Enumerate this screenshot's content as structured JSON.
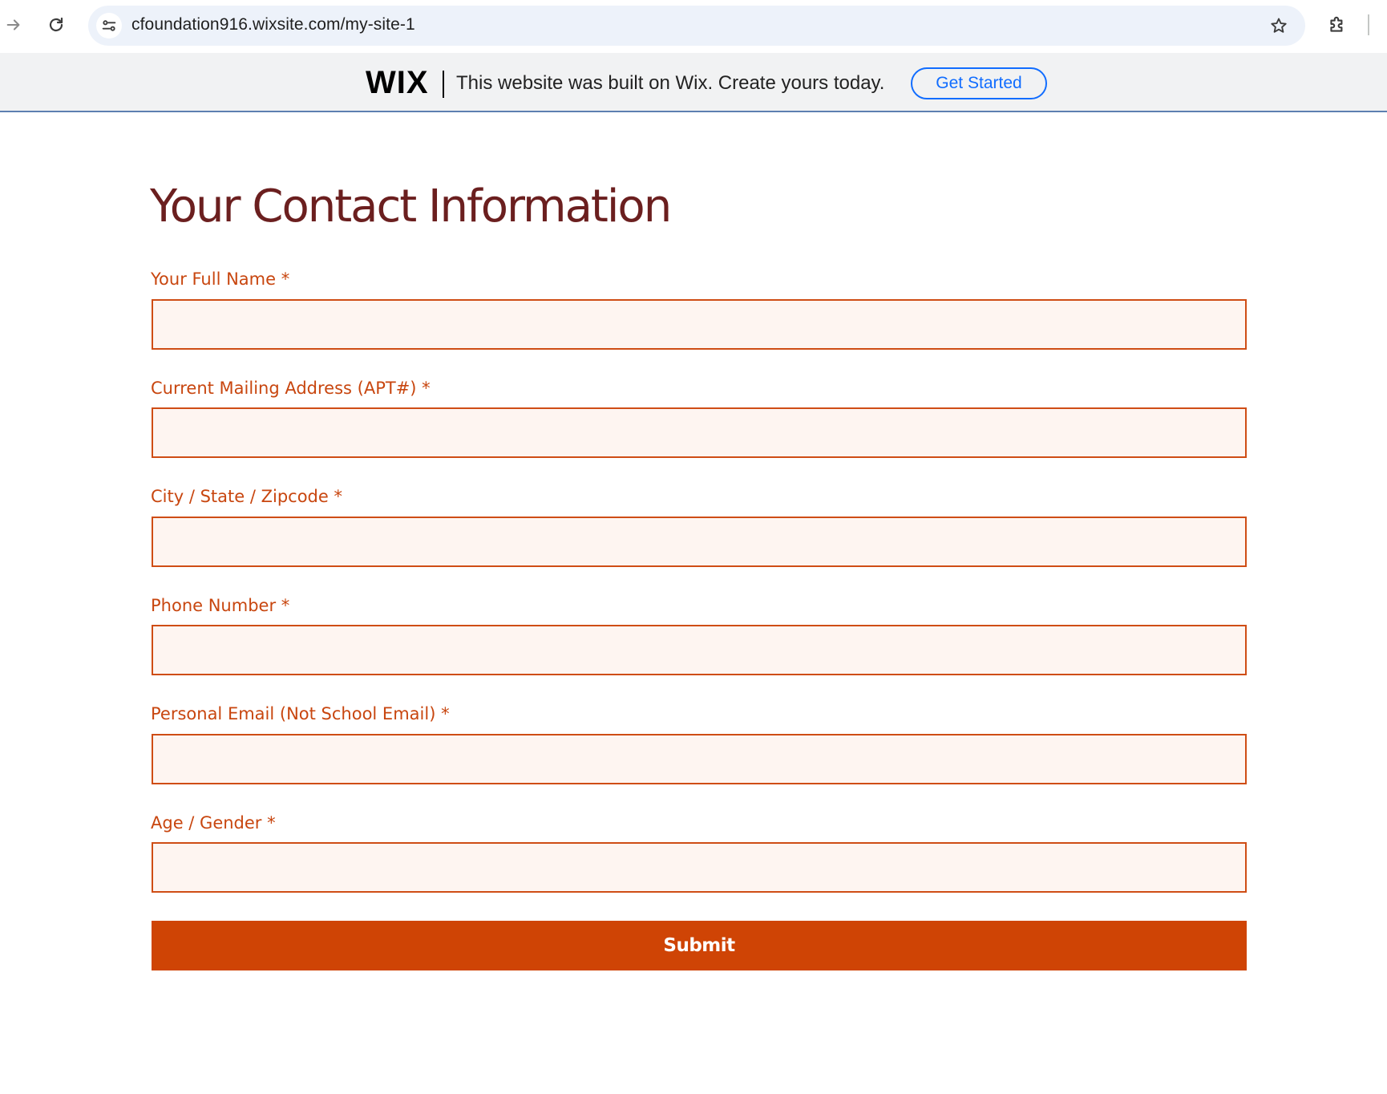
{
  "browser": {
    "url": "cfoundation916.wixsite.com/my-site-1",
    "icons": {
      "forward": "arrow-forward-icon",
      "reload": "reload-icon",
      "site_info": "tune-icon",
      "bookmark": "star-icon",
      "extensions": "puzzle-icon"
    }
  },
  "banner": {
    "logo": "WIX",
    "message": "This website was built on Wix. Create yours today.",
    "cta_label": "Get Started"
  },
  "form": {
    "title": "Your Contact Information",
    "fields": [
      {
        "label": "Your Full Name *",
        "value": ""
      },
      {
        "label": "Current Mailing Address (APT#) *",
        "value": ""
      },
      {
        "label": "City / State / Zipcode *",
        "value": ""
      },
      {
        "label": "Phone Number *",
        "value": ""
      },
      {
        "label": "Personal Email (Not School Email) *",
        "value": ""
      },
      {
        "label": "Age / Gender *",
        "value": ""
      }
    ],
    "submit_label": "Submit"
  },
  "colors": {
    "title": "#6b1f1f",
    "label": "#c8460f",
    "input_border": "#cf4d15",
    "input_background": "#fef5f1",
    "button": "#cf4405",
    "banner_cta": "#116dff"
  }
}
